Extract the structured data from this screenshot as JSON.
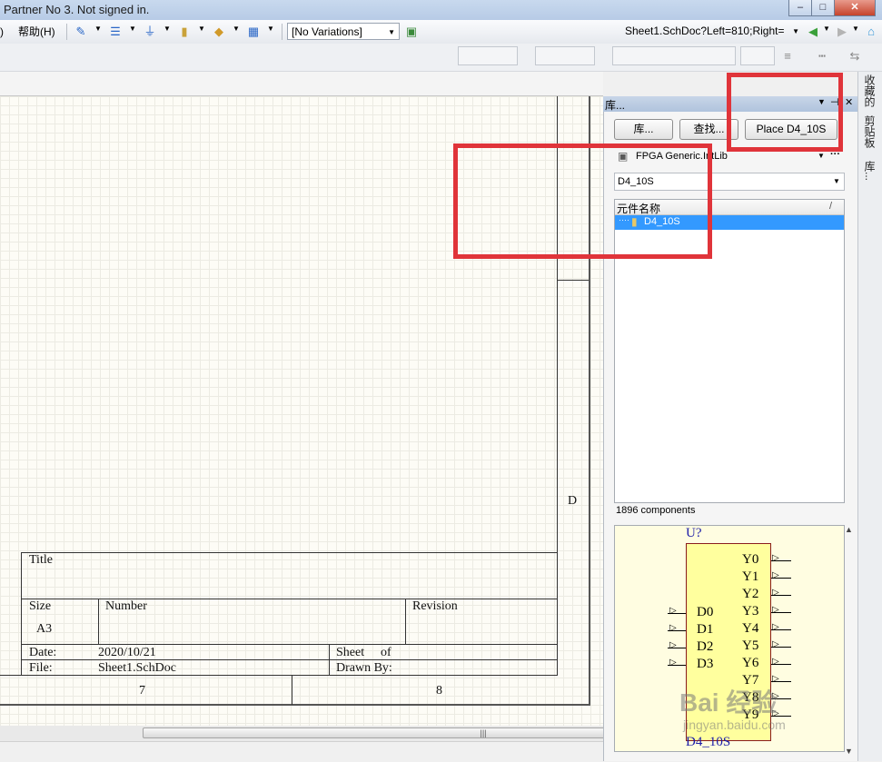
{
  "window": {
    "title": "Partner No 3. Not signed in.",
    "controls": {
      "minimize": "–",
      "maximize": "□",
      "close": "✕"
    }
  },
  "toolbar": {
    "left_fragment": ")",
    "help_menu": "帮助(H)",
    "variations": "[No Variations]",
    "address": "Sheet1.SchDoc?Left=810;Right="
  },
  "library_panel": {
    "title": "库...",
    "buttons": {
      "libraries": "库...",
      "search": "查找...",
      "place": "Place D4_10S"
    },
    "library_selector": "FPGA Generic.IntLib",
    "filter_value": "D4_10S",
    "column_header": "元件名称",
    "column_sort": "/",
    "items": [
      {
        "name": "D4_10S",
        "selected": true
      }
    ],
    "count_text": "1896 components",
    "preview": {
      "designator": "U?",
      "comment": "D4_10S",
      "inputs": [
        "D0",
        "D1",
        "D2",
        "D3"
      ],
      "outputs": [
        "Y0",
        "Y1",
        "Y2",
        "Y3",
        "Y4",
        "Y5",
        "Y6",
        "Y7",
        "Y8",
        "Y9"
      ]
    }
  },
  "side_tabs": [
    "收藏的",
    "剪贴板",
    "库..."
  ],
  "schematic": {
    "zone_letter": "D",
    "column_numbers": [
      "7",
      "8"
    ],
    "title_block": {
      "title_label": "Title",
      "size_label": "Size",
      "size_value": "A3",
      "number_label": "Number",
      "revision_label": "Revision",
      "date_label": "Date:",
      "date_value": "2020/10/21",
      "sheet_label": "Sheet",
      "of_label": "of",
      "file_label": "File:",
      "file_value": "Sheet1.SchDoc",
      "drawn_by_label": "Drawn By:"
    }
  },
  "scrollbar_grip": "|||",
  "watermark": {
    "brand": "Bai 经验",
    "url": "jingyan.baidu.com"
  },
  "colors": {
    "selection": "#3399ff",
    "annotation_red": "#e0343a",
    "canvas_bg": "#fdfcf6",
    "preview_body": "#ffff9e",
    "preview_text_blue": "#1c1ca8"
  }
}
